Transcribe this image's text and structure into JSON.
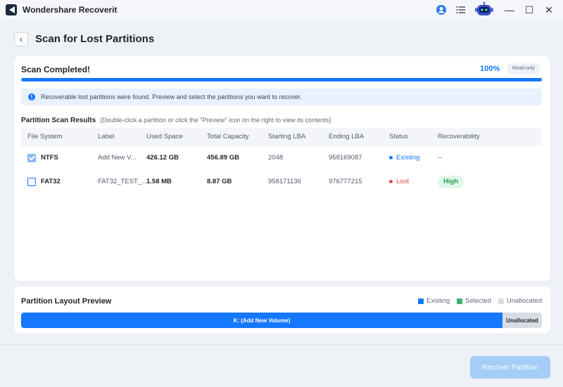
{
  "window": {
    "title": "Wondershare Recoverit",
    "controls": {
      "minimize": "—",
      "maximize": "☐",
      "close": "✕"
    }
  },
  "header": {
    "back_label": "‹",
    "title": "Scan for Lost Partitions"
  },
  "scan": {
    "title": "Scan Completed!",
    "percent": "100%",
    "progress_fraction": 1.0,
    "mode_badge": "Read-only"
  },
  "info": {
    "message": "Recoverable lost partitions were found. Preview and select the partitions you want to recover."
  },
  "results": {
    "title": "Partition Scan Results",
    "hint": "(Double-click a partition or click the \"Preview\" icon on the right to view its contents)",
    "columns": [
      "File System",
      "Label",
      "Used Space",
      "Total Capacity",
      "Starting LBA",
      "Ending LBA",
      "Status",
      "Recoverability"
    ],
    "rows": [
      {
        "checked": true,
        "file_system": "NTFS",
        "label": "Add New V...",
        "used_space": "426.12 GB",
        "total_capacity": "456.89 GB",
        "starting_lba": "2048",
        "ending_lba": "958169087",
        "status": "Existing",
        "recoverability": "--"
      },
      {
        "checked": false,
        "file_system": "FAT32",
        "label": "FAT32_TEST_...",
        "used_space": "1.58 MB",
        "total_capacity": "8.87 GB",
        "starting_lba": "958171136",
        "ending_lba": "976777215",
        "status": "Lost",
        "recoverability": "High"
      }
    ]
  },
  "preview": {
    "title": "Partition Layout Preview",
    "legend": {
      "existing": "Existing",
      "selected": "Selected",
      "unallocated": "Unallocated"
    },
    "segments": {
      "existing_label": "K: (Add New Volume)",
      "unallocated_label": "Unallocated"
    }
  },
  "footer": {
    "recover_label": "Recover Partition"
  },
  "colors": {
    "accent": "#1677ff",
    "selected": "#3bb273",
    "unallocated": "#d9dde3",
    "lost": "#e5484d",
    "high_badge": "#1f9d55"
  }
}
